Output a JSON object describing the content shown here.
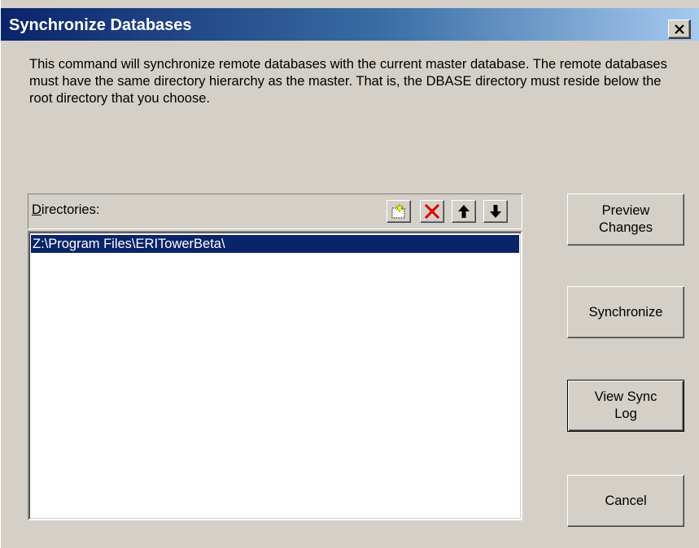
{
  "window": {
    "title": "Synchronize Databases",
    "close_icon": "close-icon"
  },
  "description": "This command will synchronize remote databases with the current master database. The remote databases must have the same directory hierarchy as the master. That is, the DBASE directory must reside below the root directory that you choose.",
  "directories": {
    "label_accel": "D",
    "label_rest": "irectories:",
    "toolbar": [
      {
        "icon": "new-folder-icon"
      },
      {
        "icon": "delete-icon",
        "color": "#e00000"
      },
      {
        "icon": "arrow-up-icon"
      },
      {
        "icon": "arrow-down-icon"
      }
    ],
    "items": [
      {
        "path": "Z:\\Program Files\\ERITowerBeta\\",
        "selected": true
      }
    ]
  },
  "buttons": {
    "preview": "Preview\nChanges",
    "synchronize": "Synchronize",
    "view_log": "View Sync\nLog",
    "cancel": "Cancel"
  },
  "colors": {
    "title_start": "#0a246a",
    "title_end": "#a6caf0",
    "selection": "#0a246a",
    "face": "#d4d0c8"
  }
}
